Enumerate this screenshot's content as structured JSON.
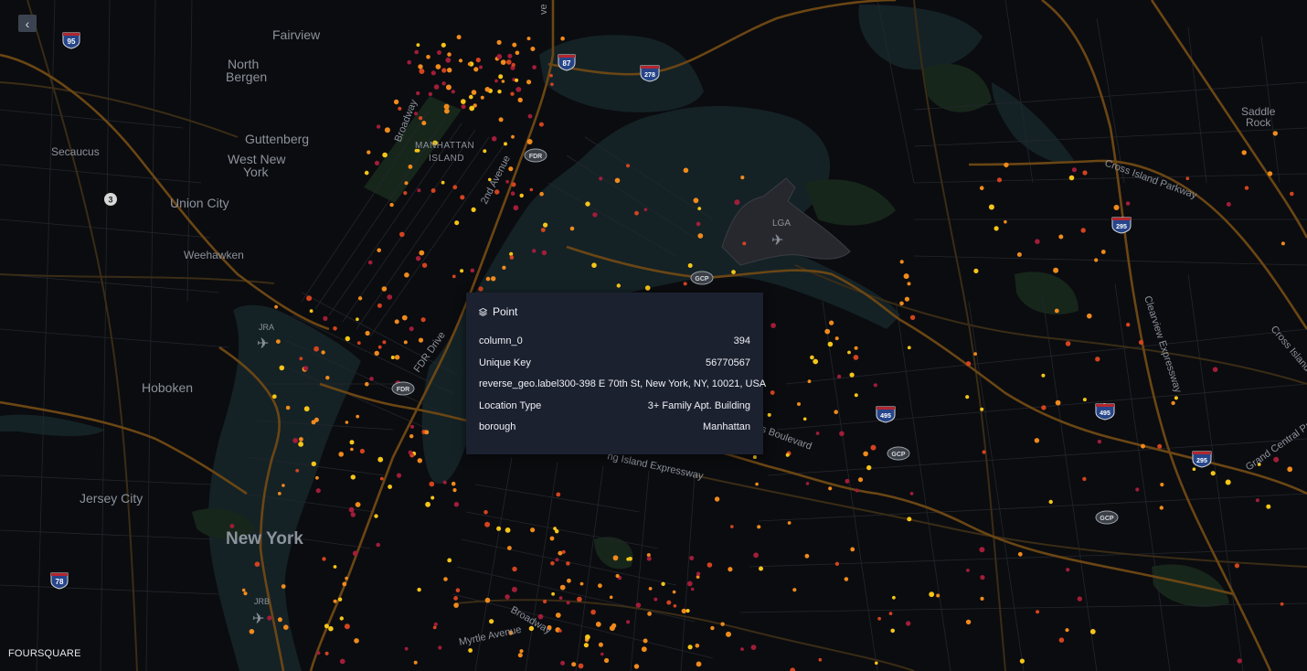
{
  "map": {
    "places": [
      {
        "id": "fairview",
        "text": "Fairview"
      },
      {
        "id": "north",
        "text": "North"
      },
      {
        "id": "bergen",
        "text": "Bergen"
      },
      {
        "id": "secaucus",
        "text": "Secaucus"
      },
      {
        "id": "guttenberg",
        "text": "Guttenberg"
      },
      {
        "id": "westnew",
        "text": "West New"
      },
      {
        "id": "york",
        "text": "York"
      },
      {
        "id": "unioncity",
        "text": "Union City"
      },
      {
        "id": "weehawken",
        "text": "Weehawken"
      },
      {
        "id": "hoboken",
        "text": "Hoboken"
      },
      {
        "id": "jerseycity",
        "text": "Jersey City"
      },
      {
        "id": "newyork",
        "text": "New York"
      },
      {
        "id": "manhattan",
        "text": "MANHATTAN"
      },
      {
        "id": "island",
        "text": "ISLAND"
      },
      {
        "id": "lga",
        "text": "LGA"
      },
      {
        "id": "jra",
        "text": "JRA"
      },
      {
        "id": "jrb",
        "text": "JRB"
      },
      {
        "id": "saddle",
        "text": "Saddle"
      },
      {
        "id": "rock",
        "text": "Rock"
      }
    ],
    "roads": [
      {
        "id": "broadway_n",
        "text": "Broadway"
      },
      {
        "id": "second_ave",
        "text": "2nd Avenue"
      },
      {
        "id": "fdr_drive",
        "text": "FDR Drive"
      },
      {
        "id": "cross_island",
        "text": "Cross Island Parkway"
      },
      {
        "id": "clearview",
        "text": "Clearview Expressway"
      },
      {
        "id": "cross_island2",
        "text": "Cross Island Pa"
      },
      {
        "id": "grand_central",
        "text": "Grand Central Parkw"
      },
      {
        "id": "li_expressway",
        "text": "ng Island Expressway"
      },
      {
        "id": "boulevard",
        "text": "s Boulevard"
      },
      {
        "id": "myrtle",
        "text": "Myrtle Avenue"
      },
      {
        "id": "broadway_s",
        "text": "Broadway"
      },
      {
        "id": "ave_top",
        "text": "ve"
      }
    ],
    "shields": [
      {
        "id": "i95",
        "text": "95",
        "kind": "interstate"
      },
      {
        "id": "i87",
        "text": "87",
        "kind": "interstate"
      },
      {
        "id": "i278",
        "text": "278",
        "kind": "interstate"
      },
      {
        "id": "i295a",
        "text": "295",
        "kind": "interstate"
      },
      {
        "id": "i495a",
        "text": "495",
        "kind": "interstate"
      },
      {
        "id": "i495b",
        "text": "495",
        "kind": "interstate"
      },
      {
        "id": "i295b",
        "text": "295",
        "kind": "interstate"
      },
      {
        "id": "i78",
        "text": "78",
        "kind": "interstate"
      },
      {
        "id": "r3",
        "text": "3",
        "kind": "state"
      },
      {
        "id": "fdr1",
        "text": "FDR",
        "kind": "oval"
      },
      {
        "id": "fdr2",
        "text": "FDR",
        "kind": "oval"
      },
      {
        "id": "gcp1",
        "text": "GCP",
        "kind": "oval"
      },
      {
        "id": "gcp2",
        "text": "GCP",
        "kind": "oval"
      },
      {
        "id": "gcp3",
        "text": "GCP",
        "kind": "oval"
      }
    ],
    "colors": {
      "background": "#0b0c0f",
      "water": "#142226",
      "park": "#17261b",
      "road": "#3a2c16",
      "highway": "#6b4614",
      "point_yellow": "#f5c518",
      "point_orange": "#f08a1c",
      "point_red": "#d3431f",
      "point_crimson": "#a11d3a"
    }
  },
  "tooltip": {
    "title": "Point",
    "icon": "layers-icon",
    "rows": [
      {
        "key": "column_0",
        "value": "394"
      },
      {
        "key": "Unique Key",
        "value": "56770567"
      },
      {
        "key": "reverse_geo.label",
        "value": "300-398 E 70th St, New York, NY, 10021, USA"
      },
      {
        "key": "Location Type",
        "value": "3+ Family Apt. Building"
      },
      {
        "key": "borough",
        "value": "Manhattan"
      }
    ]
  },
  "controls": {
    "collapse_icon": "chevron-left-icon",
    "collapse_glyph": "‹"
  },
  "brand": {
    "text": "FOURSQUARE"
  }
}
